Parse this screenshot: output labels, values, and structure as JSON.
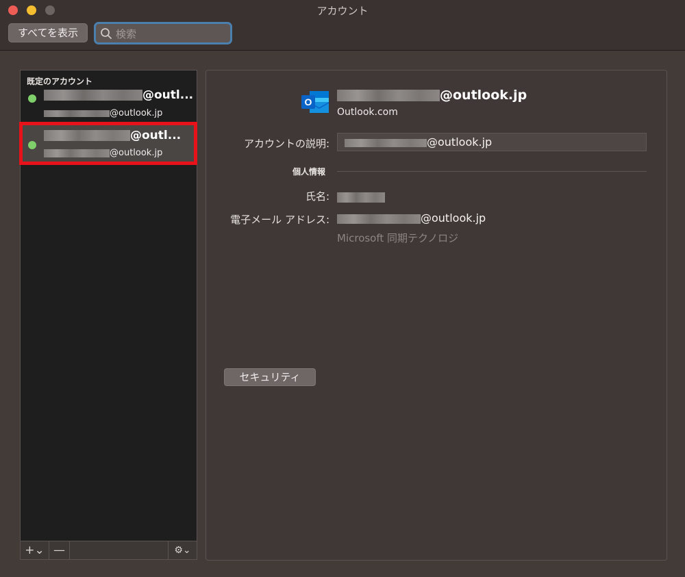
{
  "window": {
    "title": "アカウント"
  },
  "toolbar": {
    "show_all_label": "すべてを表示",
    "search_placeholder": "検索"
  },
  "sidebar": {
    "header": "既定のアカウント",
    "accounts": [
      {
        "name_suffix": "@outl...",
        "email_suffix": "@outlook.jp",
        "status": "online",
        "selected": false
      },
      {
        "name_suffix": "@outl...",
        "email_suffix": "@outlook.jp",
        "status": "online",
        "selected": true
      }
    ],
    "add_label": "+⌄",
    "remove_label": "—",
    "gear_label": "⚙⌄"
  },
  "detail": {
    "email_suffix": "@outlook.jp",
    "account_type": "Outlook.com",
    "description_label": "アカウントの説明:",
    "description_suffix": "@outlook.jp",
    "personal_info_label": "個人情報",
    "name_label": "氏名:",
    "email_label": "電子メール アドレス:",
    "email_value_suffix": "@outlook.jp",
    "sync_technology": "Microsoft 同期テクノロジ",
    "security_button": "セキュリティ"
  },
  "colors": {
    "status_online": "#7fd06a",
    "selection_highlight": "#e8121b",
    "search_focus": "#4a7fae",
    "outlook_blue": "#0a64c8"
  }
}
